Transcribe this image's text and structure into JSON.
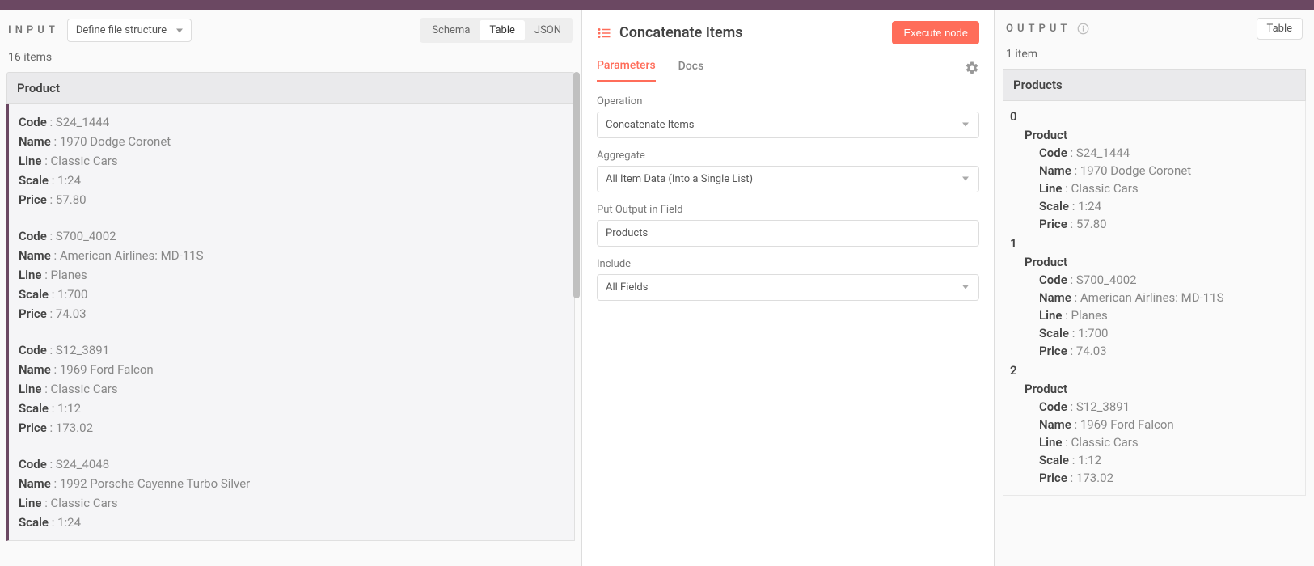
{
  "input": {
    "title": "INPUT",
    "source": "Define file structure",
    "views": [
      "Schema",
      "Table",
      "JSON"
    ],
    "items_count": "16 items",
    "column": "Product",
    "prop_labels": {
      "code": "Code",
      "name": "Name",
      "line": "Line",
      "scale": "Scale",
      "price": "Price"
    },
    "items": [
      {
        "code": "S24_1444",
        "name": "1970 Dodge Coronet",
        "line": "Classic Cars",
        "scale": "1:24",
        "price": "57.80"
      },
      {
        "code": "S700_4002",
        "name": "American Airlines: MD-11S",
        "line": "Planes",
        "scale": "1:700",
        "price": "74.03"
      },
      {
        "code": "S12_3891",
        "name": "1969 Ford Falcon",
        "line": "Classic Cars",
        "scale": "1:12",
        "price": "173.02"
      },
      {
        "code": "S24_4048",
        "name": "1992 Porsche Cayenne Turbo Silver",
        "line": "Classic Cars",
        "scale": "1:24",
        "price": ""
      }
    ]
  },
  "node": {
    "title": "Concatenate Items",
    "execute_label": "Execute node",
    "tabs": [
      "Parameters",
      "Docs"
    ],
    "params": {
      "operation": {
        "label": "Operation",
        "value": "Concatenate Items"
      },
      "aggregate": {
        "label": "Aggregate",
        "value": "All Item Data (Into a Single List)"
      },
      "output_field": {
        "label": "Put Output in Field",
        "value": "Products"
      },
      "include": {
        "label": "Include",
        "value": "All Fields"
      }
    }
  },
  "output": {
    "title": "OUTPUT",
    "view": "Table",
    "items_count": "1 item",
    "column": "Products",
    "product_label": "Product",
    "prop_labels": {
      "code": "Code",
      "name": "Name",
      "line": "Line",
      "scale": "Scale",
      "price": "Price"
    },
    "items": [
      {
        "code": "S24_1444",
        "name": "1970 Dodge Coronet",
        "line": "Classic Cars",
        "scale": "1:24",
        "price": "57.80"
      },
      {
        "code": "S700_4002",
        "name": "American Airlines: MD-11S",
        "line": "Planes",
        "scale": "1:700",
        "price": "74.03"
      },
      {
        "code": "S12_3891",
        "name": "1969 Ford Falcon",
        "line": "Classic Cars",
        "scale": "1:12",
        "price": "173.02"
      }
    ]
  }
}
